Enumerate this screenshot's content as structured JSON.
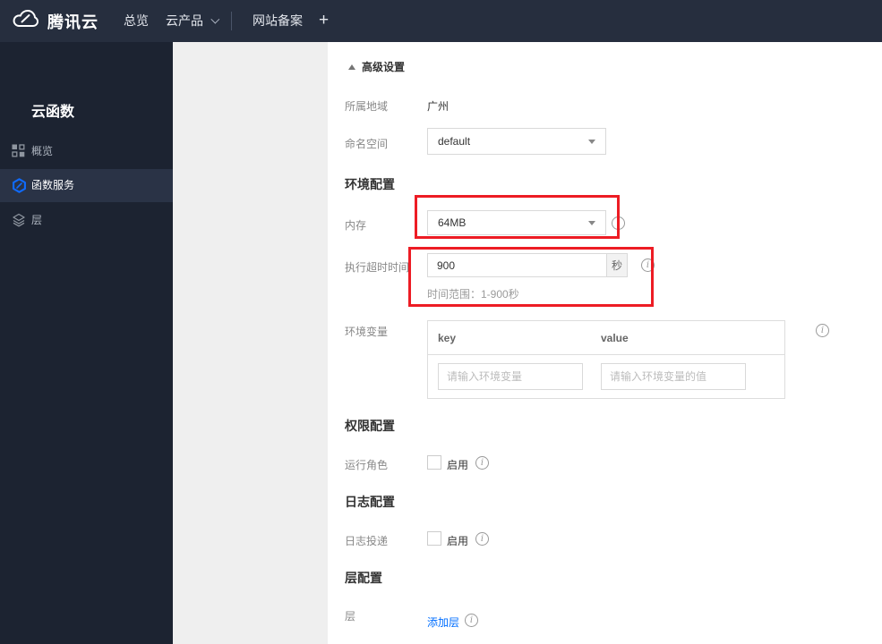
{
  "navbar": {
    "brand": "腾讯云",
    "overview": "总览",
    "products": "云产品",
    "icp": "网站备案",
    "plus": "+"
  },
  "sidebar": {
    "title": "云函数",
    "items": [
      {
        "label": "概览",
        "icon": "grid-icon",
        "active": false
      },
      {
        "label": "函数服务",
        "icon": "scf-hexagon-icon",
        "active": true
      },
      {
        "label": "层",
        "icon": "layers-icon",
        "active": false
      }
    ]
  },
  "form": {
    "advanced_toggle_label": "高级设置",
    "region_label": "所属地域",
    "region_value": "广州",
    "namespace_label": "命名空间",
    "namespace_value": "default",
    "env_section_title": "环境配置",
    "memory_label": "内存",
    "memory_value": "64MB",
    "timeout_label": "执行超时时间",
    "timeout_value": "900",
    "timeout_unit": "秒",
    "timeout_hint": "时间范围：1-900秒",
    "envvar_label": "环境变量",
    "envvar_col_key": "key",
    "envvar_col_value": "value",
    "envvar_key_placeholder": "请输入环境变量",
    "envvar_value_placeholder": "请输入环境变量的值",
    "perm_section_title": "权限配置",
    "runrole_label": "运行角色",
    "runrole_checkbox_label": "启用",
    "runrole_checked": false,
    "log_section_title": "日志配置",
    "logship_label": "日志投递",
    "logship_checkbox_label": "启用",
    "logship_checked": false,
    "layer_section_title": "层配置",
    "layer_label": "层",
    "add_layer_link": "添加层",
    "info_icon_glyph": "i"
  },
  "colors": {
    "accent_blue": "#006eff",
    "annotation_red": "#ed1c24",
    "navbar_bg": "#262e3e",
    "sidebar_bg": "#1c2331",
    "sidebar_active_bg": "#2a3346",
    "secondary_panel_bg": "#efefef"
  }
}
